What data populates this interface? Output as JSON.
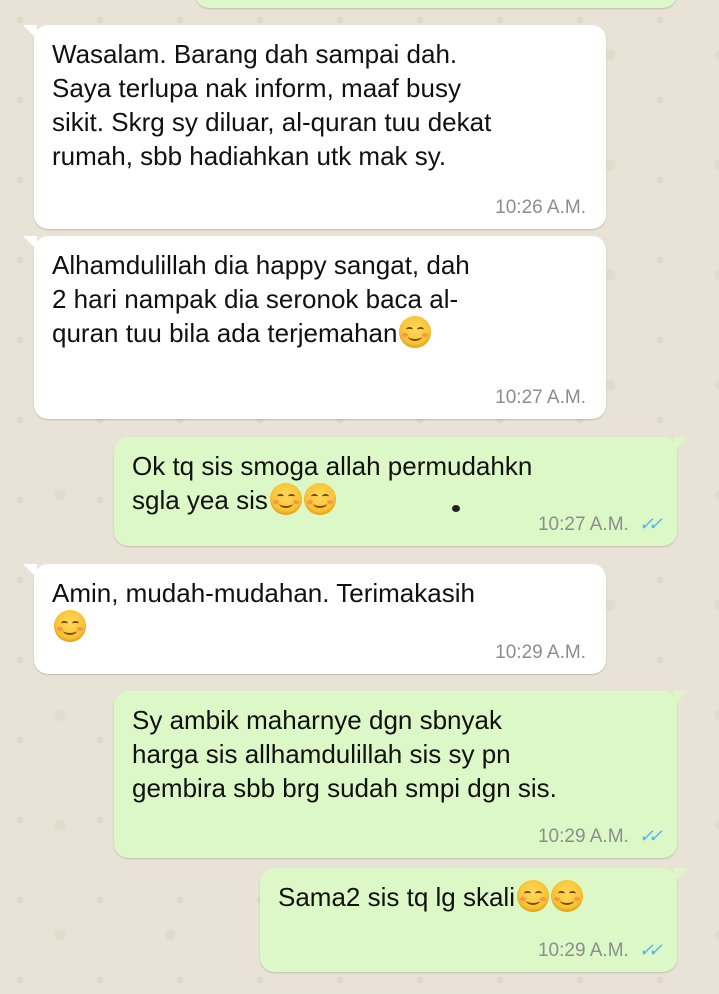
{
  "messages": [
    {
      "direction": "incoming",
      "text": "Wasalam. Barang dah sampai dah.\nSaya terlupa nak inform, maaf busy\nsikit. Skrg sy diluar, al-quran tuu dekat\nrumah, sbb hadiahkan utk mak sy.",
      "time": "10:26 A.M."
    },
    {
      "direction": "incoming",
      "text": "Alhamdulillah dia happy sangat, dah\n2 hari nampak dia seronok baca al-\nquran tuu bila ada terjemahan",
      "emoji": [
        "smiling-face-icon"
      ],
      "time": "10:27 A.M."
    },
    {
      "direction": "outgoing",
      "text": "Ok tq sis smoga allah permudahkn\nsgla yea sis",
      "emoji": [
        "relieved-face-icon",
        "relieved-face-icon"
      ],
      "time": "10:27 A.M.",
      "status": "read"
    },
    {
      "direction": "incoming",
      "text": "Amin, mudah-mudahan. Terimakasih",
      "emoji": [
        "smiling-face-icon"
      ],
      "time": "10:29 A.M."
    },
    {
      "direction": "outgoing",
      "text": "Sy ambik maharnye dgn sbnyak\nharga sis allhamdulillah sis sy pn\ngembira sbb brg sudah smpi dgn sis.",
      "time": "10:29 A.M.",
      "status": "read"
    },
    {
      "direction": "outgoing",
      "text": "Sama2 sis tq lg skali",
      "emoji": [
        "relieved-face-icon",
        "relieved-face-icon"
      ],
      "time": "10:29 A.M.",
      "status": "read"
    }
  ],
  "status_icons": {
    "read": "double-check-icon"
  },
  "colors": {
    "incoming_bubble": "#ffffff",
    "outgoing_bubble": "#dcf8c6",
    "read_ticks": "#4fb6ec",
    "wallpaper": "#e9e2d6"
  }
}
